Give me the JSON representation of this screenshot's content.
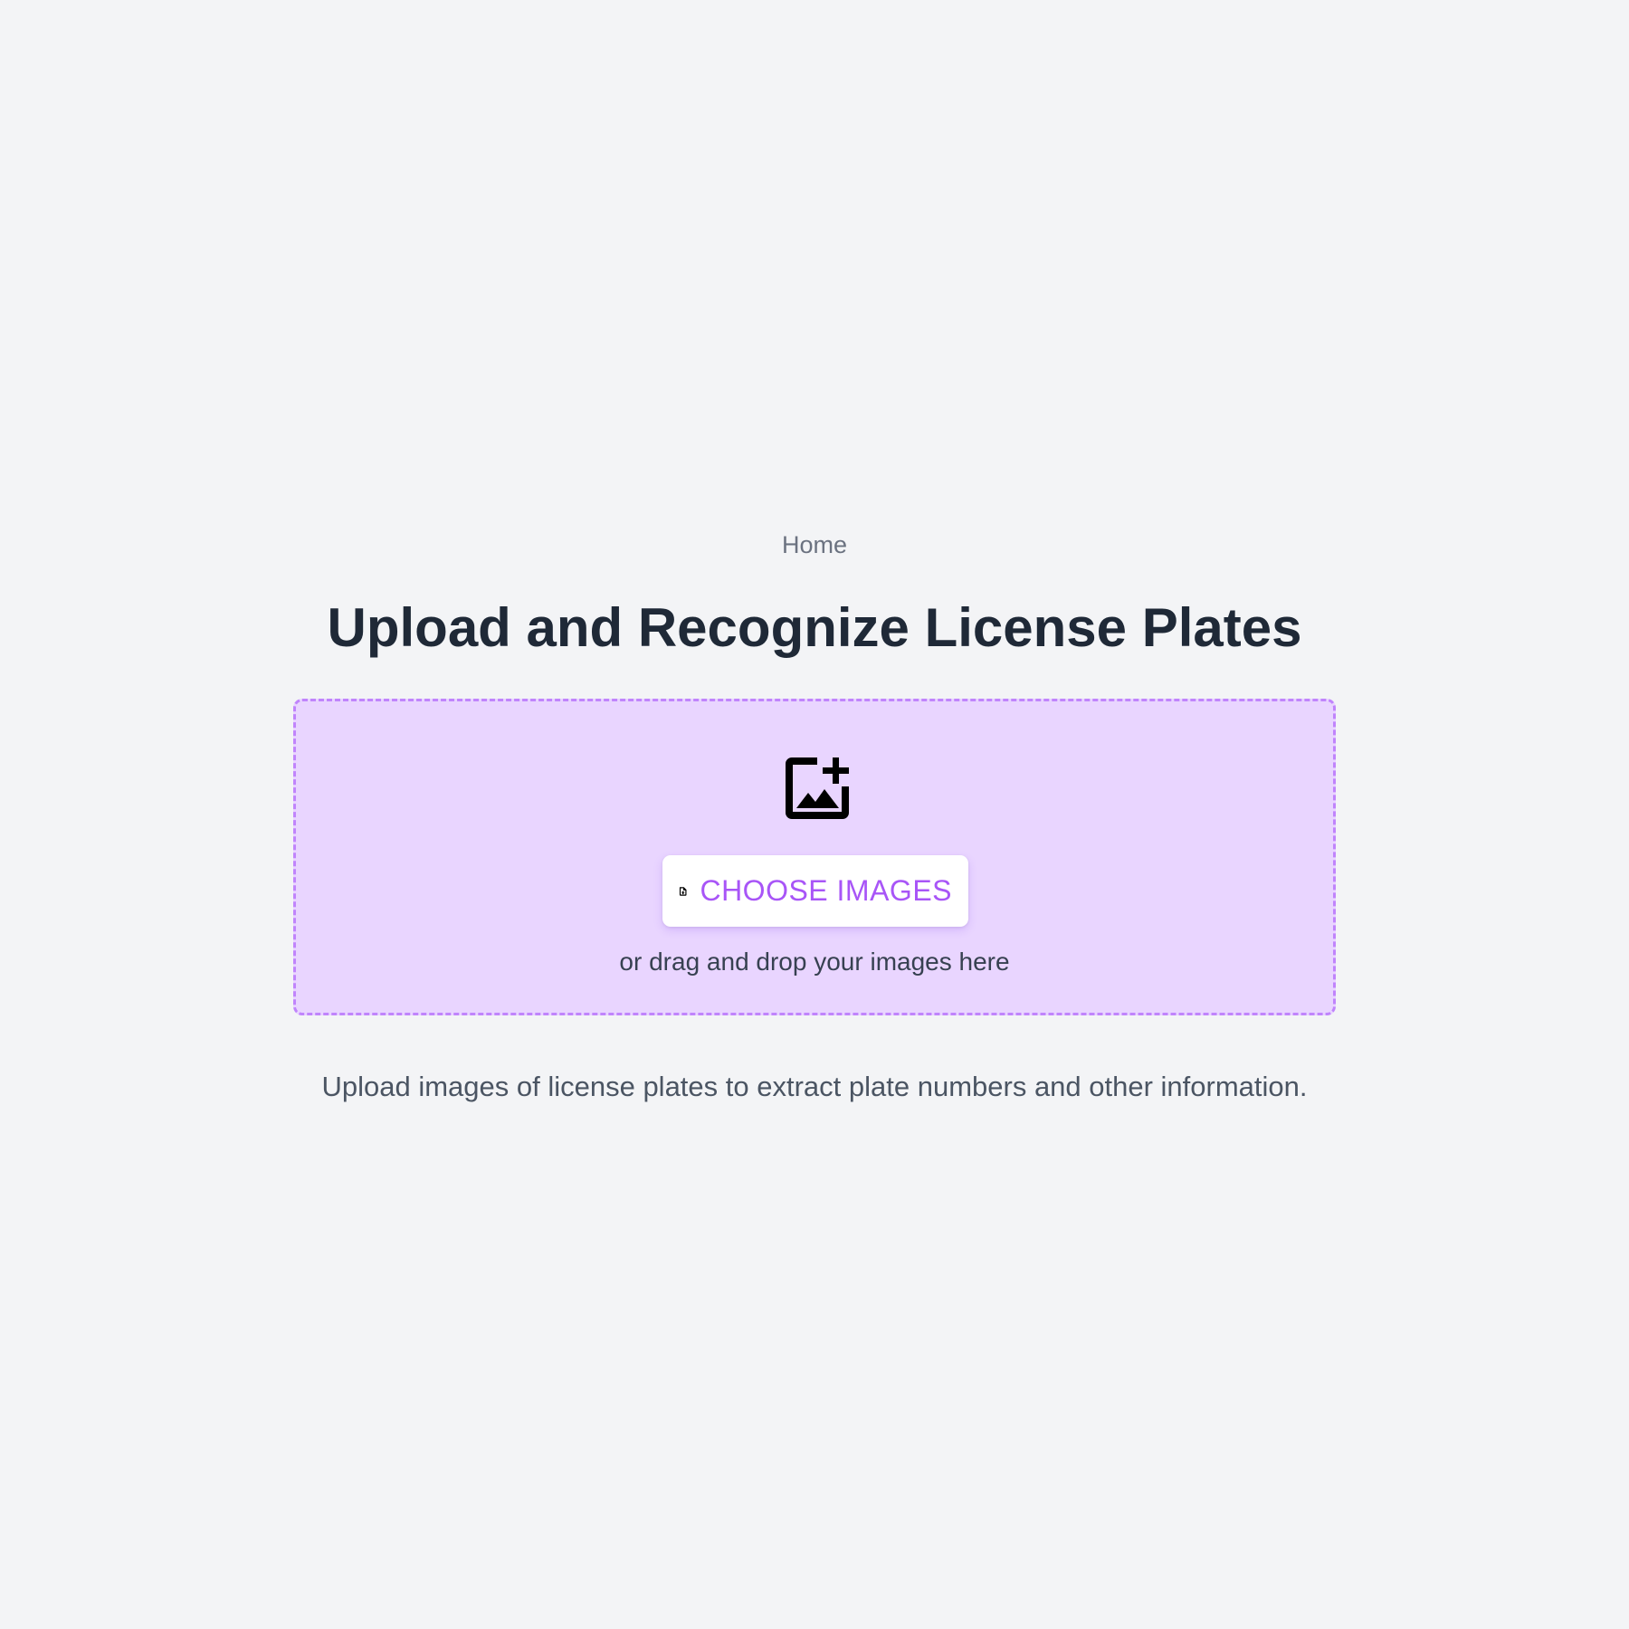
{
  "breadcrumb": {
    "label": "Home"
  },
  "header": {
    "title": "Upload and Recognize License Plates"
  },
  "dropzone": {
    "icon": "image-add-icon",
    "button_icon": "file-upload-icon",
    "button_label": "CHOOSE IMAGES",
    "hint": "or drag and drop your images here",
    "accent_color": "#a855f7",
    "background_color": "#e9d5ff",
    "border_color": "#c084fc"
  },
  "footer": {
    "description": "Upload images of license plates to extract plate numbers and other information."
  }
}
